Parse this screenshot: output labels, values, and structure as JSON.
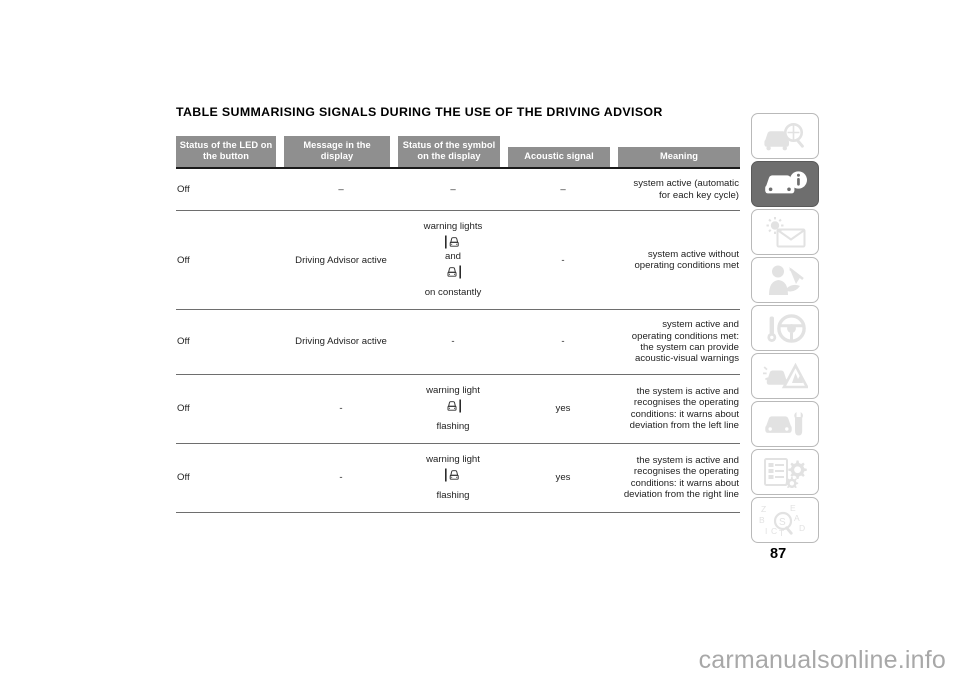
{
  "document": {
    "title": "TABLE SUMMARISING SIGNALS DURING THE USE OF THE DRIVING ADVISOR",
    "page_number": "87",
    "watermark": "carmanualsonline.info"
  },
  "table": {
    "headers": [
      "Status of the LED on the button",
      "Message in the display",
      "Status of the symbol on the display",
      "Acoustic signal",
      "Meaning"
    ],
    "header_lines": [
      [
        "Status of the LED on",
        "the button"
      ],
      [
        "Message in the",
        "display"
      ],
      [
        "Status of the symbol",
        "on the display"
      ],
      [
        "Acoustic signal"
      ],
      [
        "Meaning"
      ]
    ],
    "rows": [
      {
        "led": "Off",
        "message": "–",
        "symbol_top": "–",
        "symbol_mid": "",
        "symbol_bottom": "",
        "symbol_icons": [],
        "acoustic": "–",
        "meaning": "system active (automatic for each key cycle)"
      },
      {
        "led": "Off",
        "message": "Driving Advisor active",
        "symbol_top": "warning lights",
        "symbol_mid": "and",
        "symbol_bottom": "on constantly",
        "symbol_icons": [
          "lane-departure-left-icon",
          "lane-departure-right-icon"
        ],
        "acoustic": "-",
        "meaning": "system active without operating conditions met"
      },
      {
        "led": "Off",
        "message": "Driving Advisor active",
        "symbol_top": "-",
        "symbol_mid": "",
        "symbol_bottom": "",
        "symbol_icons": [],
        "acoustic": "-",
        "meaning": "system active and operating conditions met: the system can provide acoustic-visual warnings"
      },
      {
        "led": "Off",
        "message": "-",
        "symbol_top": "warning light",
        "symbol_mid": "",
        "symbol_bottom": "flashing",
        "symbol_icons": [
          "lane-departure-right-icon"
        ],
        "acoustic": "yes",
        "meaning": "the system is active and recognises the operating conditions: it warns about deviation from the left line"
      },
      {
        "led": "Off",
        "message": "-",
        "symbol_top": "warning light",
        "symbol_mid": "",
        "symbol_bottom": "flashing",
        "symbol_icons": [
          "lane-departure-left-icon"
        ],
        "acoustic": "yes",
        "meaning": "the system is active and recognises the operating conditions: it warns about deviation from the right line"
      }
    ]
  },
  "tab_strip": {
    "tabs": [
      {
        "icon": "car-inspection-icon",
        "active": false
      },
      {
        "icon": "car-info-icon",
        "active": true
      },
      {
        "icon": "warning-lights-messages-icon",
        "active": false
      },
      {
        "icon": "occupant-safety-icon",
        "active": false
      },
      {
        "icon": "starting-driving-icon",
        "active": false
      },
      {
        "icon": "emergency-breakdown-icon",
        "active": false
      },
      {
        "icon": "car-maintenance-icon",
        "active": false
      },
      {
        "icon": "technical-specifications-icon",
        "active": false
      },
      {
        "icon": "alphabetical-index-icon",
        "active": false
      }
    ]
  },
  "colors": {
    "header_bg": "#8f8f8f",
    "header_text": "#ffffff",
    "active_tab_bg": "#6e6e6e",
    "rule": "#6e6e6e",
    "watermark": "#a8a8a8"
  }
}
